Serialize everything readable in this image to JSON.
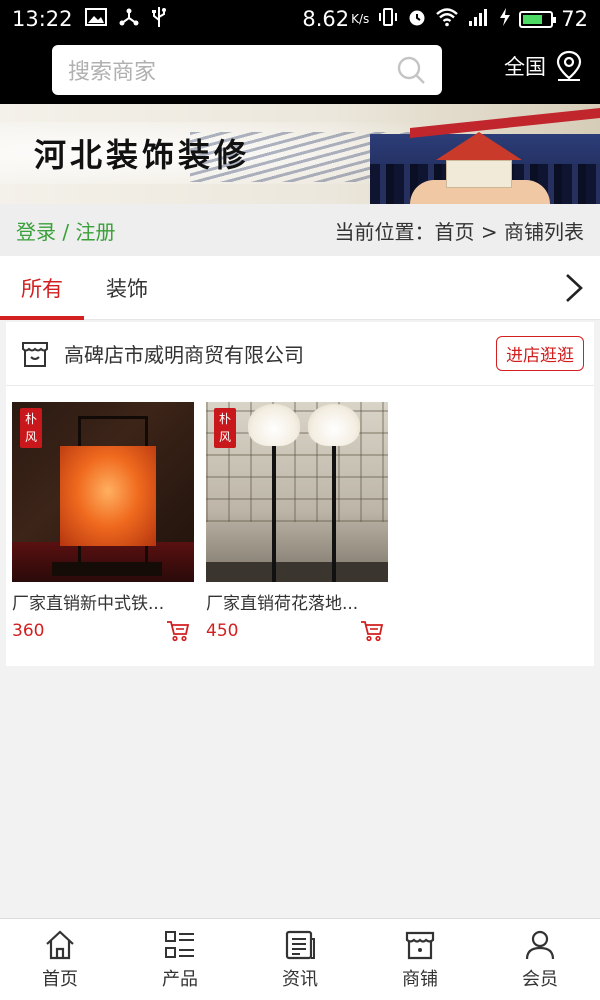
{
  "status_bar": {
    "time": "13:22",
    "speed": "8.62",
    "speed_unit": "K/s",
    "battery": "72",
    "battery_level": 0.72
  },
  "search": {
    "placeholder": "搜索商家",
    "region_label": "全国"
  },
  "banner": {
    "title": "河北装饰装修"
  },
  "breadcrumb": {
    "login": "登录",
    "separator": "/",
    "register": "注册",
    "location_prefix": "当前位置：",
    "home": "首页",
    "arrow": ">",
    "current": "商铺列表"
  },
  "tabs": [
    {
      "label": "所有",
      "active": true
    },
    {
      "label": "装饰",
      "active": false
    }
  ],
  "shop": {
    "name": "高碑店市威明商贸有限公司",
    "enter_label": "进店逛逛",
    "products": [
      {
        "name": "厂家直销新中式铁...",
        "price": "360",
        "tag": "朴风"
      },
      {
        "name": "厂家直销荷花落地...",
        "price": "450",
        "tag": "朴风"
      }
    ]
  },
  "bottom_nav": [
    {
      "label": "首页",
      "icon": "home-icon"
    },
    {
      "label": "产品",
      "icon": "list-icon"
    },
    {
      "label": "资讯",
      "icon": "news-icon"
    },
    {
      "label": "商铺",
      "icon": "shop-icon"
    },
    {
      "label": "会员",
      "icon": "user-icon"
    }
  ],
  "colors": {
    "accent_red": "#d21f1f",
    "link_green": "#3aa03a",
    "top_bar": "#000000"
  }
}
